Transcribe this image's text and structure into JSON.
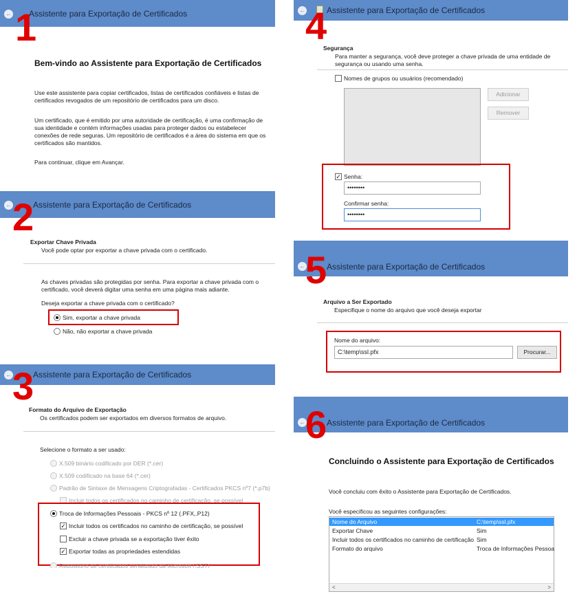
{
  "title": "Assistente para Exportação de Certificados",
  "steps": {
    "s1": {
      "number": "1",
      "heading": "Bem-vindo ao Assistente para Exportação de Certificados",
      "p1a": "Use este assistente para copiar certificados, listas de certificados confiáveis e listas de",
      "p1b": "certificados revogados de um repositório de certificados para um disco.",
      "p2a": "Um certificado, que é emitido por uma autoridade de certificação, é uma confirmação de",
      "p2b": "sua identidade e contém informações usadas para proteger dados ou estabelecer",
      "p2c": "conexões de rede seguras. Um repositório de certificados é a área do sistema em que os",
      "p2d": "certificados são mantidos.",
      "p3": "Para continuar, clique em Avançar."
    },
    "s2": {
      "number": "2",
      "section": "Exportar Chave Privada",
      "sub": "Você pode optar por exportar a chave privada com o certificado.",
      "p1a": "As chaves privadas são protegidas por senha. Para exportar a chave privada com o",
      "p1b": "certificado, você deverá digitar uma senha em uma página mais adiante.",
      "question": "Deseja exportar a chave privada com o certificado?",
      "opt_yes": "Sim, exportar a chave privada",
      "opt_no": "Não, não exportar a chave privada"
    },
    "s3": {
      "number": "3",
      "section": "Formato do Arquivo de Exportação",
      "sub": "Os certificados podem ser exportados em diversos formatos de arquivo.",
      "prompt": "Selecione o formato a ser usado:",
      "opt_der": "X.509 binário codificado por DER (*.cer)",
      "opt_b64": "X.509 codificado na base 64 (*.cer)",
      "opt_p7b": "Padrão de Sintaxe de Mensagens Criptografadas - Certificados PKCS nº7 (*.p7b)",
      "opt_p7b_chain": "Incluir todos os certificados no caminho de certificação, se possível",
      "opt_pfx": "Troca de Informações Pessoais - PKCS nº 12 (.PFX,.P12)",
      "pfx_chain": "Incluir todos os certificados no caminho de certificação, se possível",
      "pfx_delete": "Excluir a chave privada se a exportação tiver êxito",
      "pfx_props": "Exportar todas as propriedades estendidas",
      "opt_sst": "Repositório de certificados serializado da Microsoft (.SST)"
    },
    "s4": {
      "number": "4",
      "section": "Segurança",
      "sub_a": "Para manter a segurança, você deve proteger a chave privada de uma entidade de",
      "sub_b": "segurança ou usando uma senha.",
      "groups": "Nomes de grupos ou usuários (recomendado)",
      "add": "Adicionar",
      "remove": "Remover",
      "password_label": "Senha:",
      "password_value": "••••••••",
      "confirm_label": "Confirmar senha:",
      "confirm_value": "••••••••"
    },
    "s5": {
      "number": "5",
      "section": "Arquivo a Ser Exportado",
      "sub": "Especifique o nome do arquivo que você deseja exportar",
      "filename_label": "Nome do arquivo:",
      "filename_value": "C:\\temp\\ssl.pfx",
      "browse": "Procurar..."
    },
    "s6": {
      "number": "6",
      "heading": "Concluindo o Assistente para Exportação de Certificados",
      "p1": "Você concluiu com êxito o Assistente para Exportação de Certificados.",
      "p2": "Você especificou as seguintes configurações:",
      "rows": [
        {
          "k": "Nome do Arquivo",
          "v": "C:\\temp\\ssl.pfx"
        },
        {
          "k": "Exportar Chave",
          "v": "Sim"
        },
        {
          "k": "Incluir todos os certificados no caminho de certificação",
          "v": "Sim"
        },
        {
          "k": "Formato do arquivo",
          "v": "Troca de Informações Pessoa"
        }
      ],
      "scroll_left": "<",
      "scroll_right": ">"
    }
  },
  "colors": {
    "titlebar": "#5e8bc9",
    "highlight_box": "#d40000",
    "selection": "#3399ff"
  },
  "icons": {
    "back": "back-arrow-icon",
    "certificate": "certificate-icon"
  }
}
